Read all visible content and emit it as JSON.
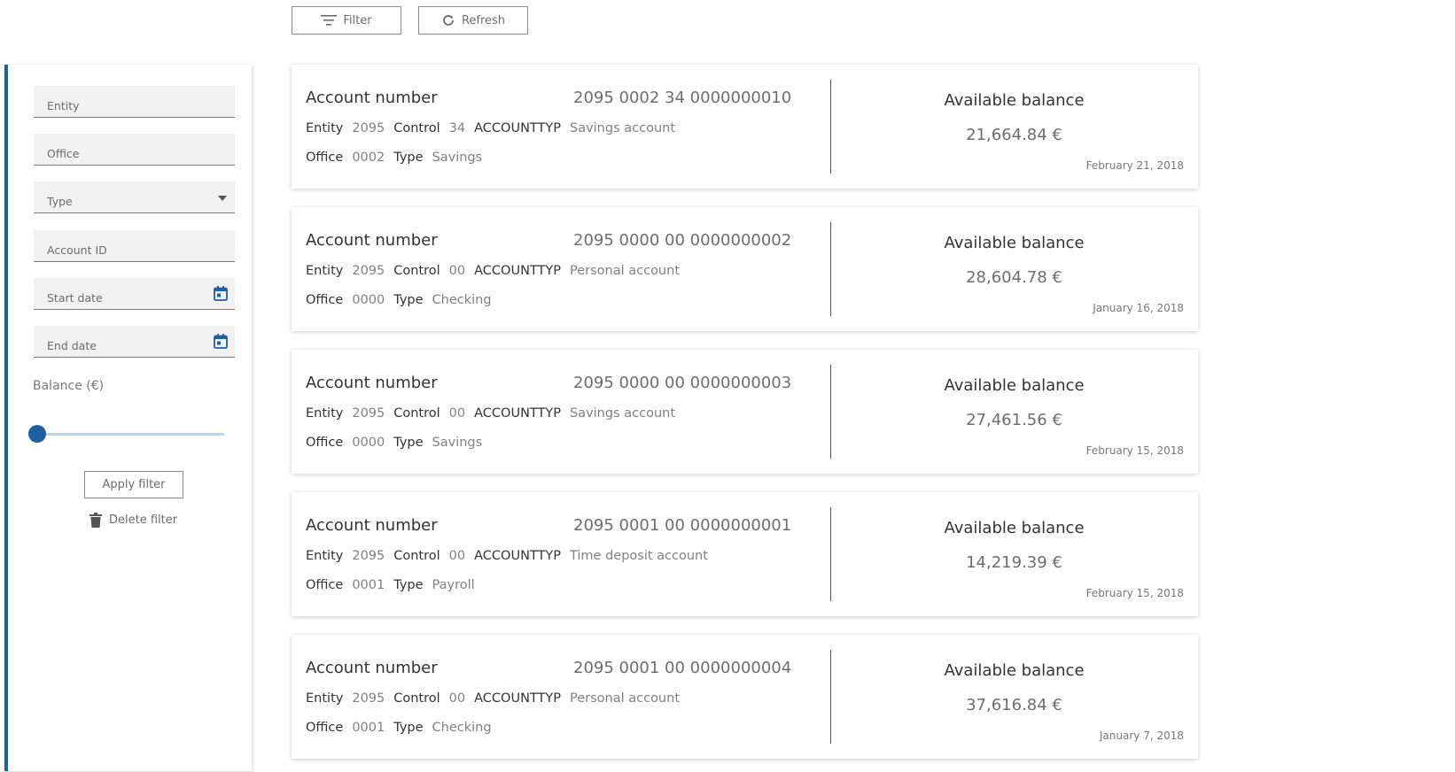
{
  "toolbar": {
    "filter_label": "Filter",
    "refresh_label": "Refresh"
  },
  "sidebar": {
    "entity_label": "Entity",
    "office_label": "Office",
    "type_label": "Type",
    "account_id_label": "Account ID",
    "start_date_label": "Start date",
    "end_date_label": "End date",
    "balance_label": "Balance (€)",
    "balance_slider_value": 0,
    "apply_label": "Apply filter",
    "delete_label": "Delete filter"
  },
  "card_labels": {
    "account_number": "Account number",
    "entity": "Entity",
    "control": "Control",
    "accounttyp": "ACCOUNTTYP",
    "office": "Office",
    "type": "Type",
    "available_balance": "Available balance"
  },
  "accounts": [
    {
      "number": "2095 0002 34 0000000010",
      "entity": "2095",
      "control": "34",
      "account_type": "Savings account",
      "office": "0002",
      "type": "Savings",
      "balance": "21,664.84 €",
      "date": "February 21, 2018"
    },
    {
      "number": "2095 0000 00 0000000002",
      "entity": "2095",
      "control": "00",
      "account_type": "Personal account",
      "office": "0000",
      "type": "Checking",
      "balance": "28,604.78 €",
      "date": "January 16, 2018"
    },
    {
      "number": "2095 0000 00 0000000003",
      "entity": "2095",
      "control": "00",
      "account_type": "Savings account",
      "office": "0000",
      "type": "Savings",
      "balance": "27,461.56 €",
      "date": "February 15, 2018"
    },
    {
      "number": "2095 0001 00 0000000001",
      "entity": "2095",
      "control": "00",
      "account_type": "Time deposit account",
      "office": "0001",
      "type": "Payroll",
      "balance": "14,219.39 €",
      "date": "February 15, 2018"
    },
    {
      "number": "2095 0001 00 0000000004",
      "entity": "2095",
      "control": "00",
      "account_type": "Personal account",
      "office": "0001",
      "type": "Checking",
      "balance": "37,616.84 €",
      "date": "January 7, 2018"
    }
  ],
  "colors": {
    "accent": "#1f5fa0",
    "slider_track": "#bcd3e8"
  }
}
